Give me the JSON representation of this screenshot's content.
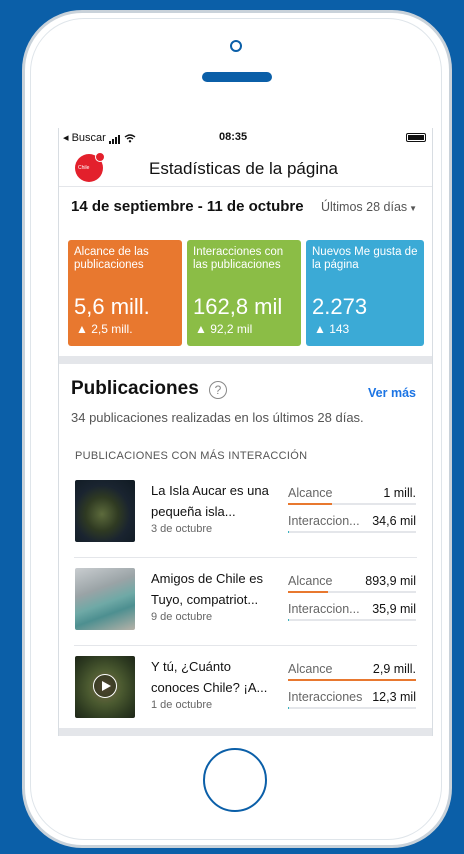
{
  "status_bar": {
    "back_label": "◂ Buscar",
    "time": "08:35"
  },
  "header": {
    "title": "Estadísticas de la página",
    "logo_text": "Chile"
  },
  "date_range": {
    "range": "14 de septiembre - 11 de octubre",
    "period": "Últimos 28 días"
  },
  "cards": [
    {
      "label": "Alcance de las publicaciones",
      "value": "5,6 mill.",
      "delta": "▲ 2,5 mill.",
      "color": "#e8782f"
    },
    {
      "label": "Interacciones con las publicaciones",
      "value": "162,8 mil",
      "delta": "▲ 92,2 mil",
      "color": "#8bbd46"
    },
    {
      "label": "Nuevos Me gusta de la página",
      "value": "2.273",
      "delta": "▲ 143",
      "color": "#3baad6"
    }
  ],
  "publications": {
    "title": "Publicaciones",
    "see_more": "Ver más",
    "subtitle": "34 publicaciones realizadas en los últimos 28 días.",
    "section_heading": "PUBLICACIONES CON MÁS INTERACCIÓN",
    "posts": [
      {
        "text": "La Isla Aucar es una pequeña isla...",
        "date": "3 de octubre",
        "reach_label": "Alcance",
        "reach_value": "1 mill.",
        "reach_fill": 0.34,
        "inter_label": "Interaccion...",
        "inter_value": "34,6 mil",
        "inter_fill": 0.01
      },
      {
        "text": "Amigos de Chile es Tuyo, compatriot...",
        "date": "9 de octubre",
        "reach_label": "Alcance",
        "reach_value": "893,9 mil",
        "reach_fill": 0.31,
        "inter_label": "Interaccion...",
        "inter_value": "35,9 mil",
        "inter_fill": 0.01
      },
      {
        "text": "Y tú, ¿Cuánto conoces Chile? ¡A...",
        "date": "1 de octubre",
        "reach_label": "Alcance",
        "reach_value": "2,9 mill.",
        "reach_fill": 1.0,
        "inter_label": "Interacciones",
        "inter_value": "12,3 mil",
        "inter_fill": 0.0
      }
    ]
  },
  "colors": {
    "background": "#0b5fa8",
    "link": "#1b74e4",
    "reach_bar": "#e8782f",
    "interaction_bar": "#3bb4c0"
  }
}
